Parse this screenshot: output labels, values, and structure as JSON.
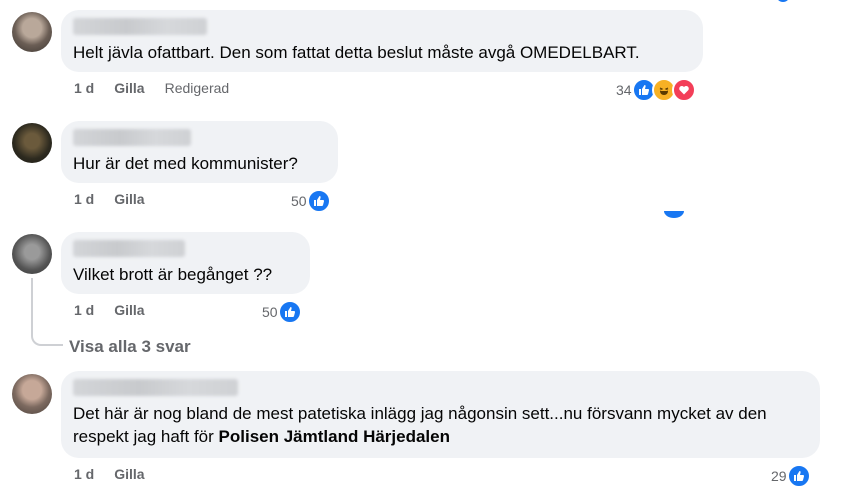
{
  "comments": [
    {
      "text": "Helt jävla ofattbart. Den som fattat detta beslut måste avgå OMEDELBART.",
      "time": "1 d",
      "like_label": "Gilla",
      "edited": "Redigerad",
      "reaction_count": "34",
      "reactions": [
        "like-icon",
        "haha-icon",
        "love-icon"
      ]
    },
    {
      "text": "Hur är det med kommunister?",
      "time": "1 d",
      "like_label": "Gilla",
      "reaction_count": "50",
      "reactions": [
        "like-icon"
      ]
    },
    {
      "text": "Vilket brott är begånget ??",
      "time": "1 d",
      "like_label": "Gilla",
      "reaction_count": "50",
      "reactions": [
        "like-icon"
      ]
    },
    {
      "text_before": "Det här är nog bland de mest patetiska inlägg jag någonsin sett...nu försvann mycket av den respekt jag haft för ",
      "text_bold": "Polisen Jämtland Härjedalen",
      "time": "1 d",
      "like_label": "Gilla",
      "reaction_count": "29",
      "reactions": [
        "like-icon"
      ]
    }
  ],
  "view_replies": "Visa alla 3 svar",
  "colors": {
    "like": "#1877f2",
    "haha": "#f7b125",
    "love": "#f33e58",
    "bubble": "#f0f2f5",
    "meta": "#65676b"
  }
}
